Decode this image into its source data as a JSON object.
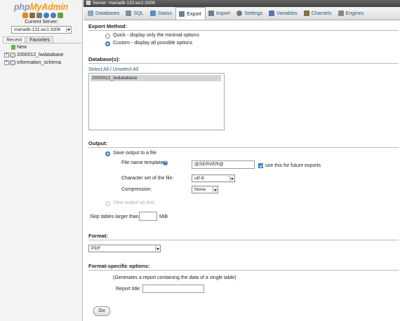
{
  "nav": {
    "logo_php": "php",
    "logo_myadmin": "MyAdmin",
    "logo_icons": [
      {
        "name": "home-icon",
        "color": "#d98a2b"
      },
      {
        "name": "logout-icon",
        "color": "#8c6b3f"
      },
      {
        "name": "sql-query-icon",
        "color": "#7a7a7a"
      },
      {
        "name": "docs-icon",
        "color": "#3d7fc2"
      },
      {
        "name": "help-icon",
        "color": "#3d7fc2"
      },
      {
        "name": "settings-icon",
        "color": "#6a9f3c"
      }
    ],
    "current_server_label": "Current Server:",
    "server_select_value": "mariadb-132.wc1:3306",
    "tabs": [
      "Recent",
      "Favorites"
    ],
    "tree": [
      {
        "label": "New",
        "type": "new"
      },
      {
        "label": "2000012_lwdatabase",
        "type": "db"
      },
      {
        "label": "information_schema",
        "type": "db"
      }
    ]
  },
  "breadcrumb": "Server: mariadb-132.wc1:3306",
  "tabs": [
    {
      "label": "Databases",
      "icon": "databases-icon",
      "color": "#8aa6c1"
    },
    {
      "label": "SQL",
      "icon": "sql-icon",
      "color": "#7f8c99"
    },
    {
      "label": "Status",
      "icon": "status-icon",
      "color": "#5a8ec9"
    },
    {
      "label": "Export",
      "icon": "export-icon",
      "color": "#6b7f96",
      "active": true
    },
    {
      "label": "Import",
      "icon": "import-icon",
      "color": "#6b7f96"
    },
    {
      "label": "Settings",
      "icon": "settings-icon",
      "color": "#7a7a7a"
    },
    {
      "label": "Variables",
      "icon": "variables-icon",
      "color": "#5577aa"
    },
    {
      "label": "Charsets",
      "icon": "charsets-icon",
      "color": "#8b6d4a"
    },
    {
      "label": "Engines",
      "icon": "engines-icon",
      "color": "#888888"
    }
  ],
  "export_method": {
    "title": "Export Method:",
    "quick": "Quick - display only the minimal options",
    "custom": "Custom - display all possible options"
  },
  "databases": {
    "title": "Database(s):",
    "select_all": "Select All",
    "separator": " / ",
    "unselect_all": "Unselect All",
    "items": [
      "2000012_lwdatabase"
    ]
  },
  "output": {
    "title": "Output:",
    "save_to_file": "Save output to a file",
    "filename_label": "File name template:",
    "filename_value": "@SERVER@",
    "remember_label": "use this for future exports",
    "charset_label": "Character set of the file:",
    "charset_value": "utf-8",
    "compression_label": "Compression:",
    "compression_value": "None",
    "view_as_text": "View output as text",
    "skip_label": "Skip tables larger than",
    "skip_value": "",
    "skip_unit": "MiB"
  },
  "format": {
    "title": "Format:",
    "value": "PDF"
  },
  "format_options": {
    "title": "Format-specific options:",
    "description": "(Generates a report containing the data of a single table)",
    "report_title_label": "Report title:",
    "report_title_value": ""
  },
  "go_label": "Go"
}
